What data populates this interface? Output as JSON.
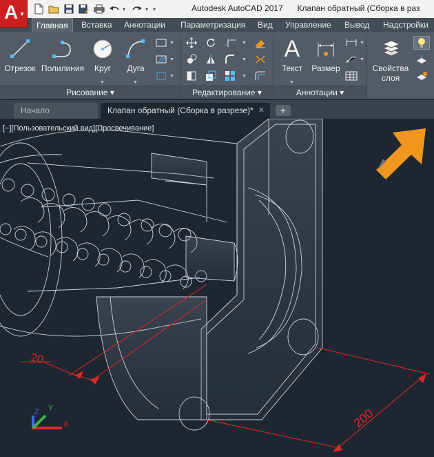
{
  "window": {
    "app_name": "Autodesk AutoCAD 2017",
    "doc_title": "Клапан обратный (Сборка в раз"
  },
  "app_button": {
    "letter": "A"
  },
  "quick_access": {
    "icons": [
      "new-icon",
      "open-icon",
      "save-icon",
      "save-as-icon",
      "print-icon",
      "undo-icon",
      "redo-icon"
    ]
  },
  "ribbon_tabs": [
    {
      "label": "Главная",
      "active": true
    },
    {
      "label": "Вставка"
    },
    {
      "label": "Аннотации"
    },
    {
      "label": "Параметризация"
    },
    {
      "label": "Вид"
    },
    {
      "label": "Управление"
    },
    {
      "label": "Вывод"
    },
    {
      "label": "Надстройки"
    }
  ],
  "panels": {
    "draw": {
      "footer": "Рисование ▾",
      "tools": [
        "Отрезок",
        "Полилиния",
        "Круг",
        "Дуга"
      ]
    },
    "modify": {
      "footer": "Редактирование ▾"
    },
    "annotation": {
      "footer": "Аннотации ▾",
      "tools": [
        "Текст",
        "Размер"
      ]
    },
    "layers": {
      "tool": "Свойства\nслоя",
      "line1": "Свойства",
      "line2": "слоя"
    }
  },
  "file_tabs": {
    "home": "Начало",
    "doc": "Клапан обратный (Сборка в разрезе)*",
    "close": "✕",
    "add": "+"
  },
  "viewport": {
    "label": "[−][Пользовательский вид][Просвечивание]",
    "dims": {
      "left": "20",
      "right": "200"
    },
    "ucs": {
      "x": "X",
      "y": "Y",
      "z": "Z"
    }
  },
  "colors": {
    "accent_orange": "#f0961e",
    "dimension_red": "#e12828",
    "wire": "#d9dde3",
    "app_red": "#cc1f1f"
  }
}
